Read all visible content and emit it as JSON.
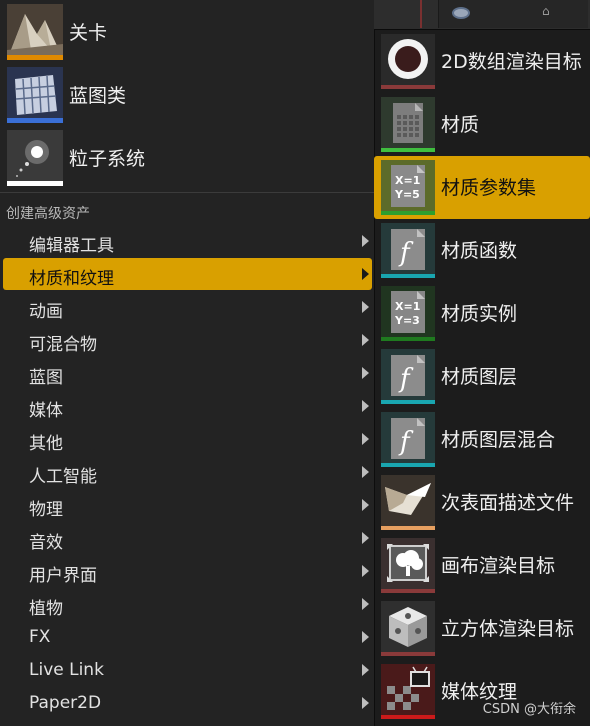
{
  "basic_assets": [
    {
      "label": "关卡",
      "bar_color": "#e08a00"
    },
    {
      "label": "蓝图类",
      "bar_color": "#3a6fd6"
    },
    {
      "label": "粒子系统",
      "bar_color": "#ffffff"
    }
  ],
  "advanced_header": "创建高级资产",
  "categories": [
    {
      "label": "编辑器工具"
    },
    {
      "label": "材质和纹理"
    },
    {
      "label": "动画"
    },
    {
      "label": "可混合物"
    },
    {
      "label": "蓝图"
    },
    {
      "label": "媒体"
    },
    {
      "label": "其他"
    },
    {
      "label": "人工智能"
    },
    {
      "label": "物理"
    },
    {
      "label": "音效"
    },
    {
      "label": "用户界面"
    },
    {
      "label": "植物"
    },
    {
      "label": "FX"
    },
    {
      "label": "Live Link"
    },
    {
      "label": "Paper2D"
    }
  ],
  "active_category": "材质和纹理",
  "submenu": [
    {
      "label": "2D数组渲染目标",
      "icon": "ring-icon",
      "bar_color": "#8a3a3a"
    },
    {
      "label": "材质",
      "icon": "material-grid-icon",
      "bar_color": "#3fbf3f"
    },
    {
      "label": "材质参数集",
      "icon": "parameter-collection-icon",
      "bar_color": "#2e9e2e",
      "icon_text_1": "X=1",
      "icon_text_2": "Y=5"
    },
    {
      "label": "材质函数",
      "icon": "function-icon",
      "bar_color": "#19a6b0"
    },
    {
      "label": "材质实例",
      "icon": "instance-icon",
      "bar_color": "#1f7a1f",
      "icon_text_1": "X=1",
      "icon_text_2": "Y=3"
    },
    {
      "label": "材质图层",
      "icon": "function-icon",
      "bar_color": "#19a6b0"
    },
    {
      "label": "材质图层混合",
      "icon": "function-icon",
      "bar_color": "#19a6b0"
    },
    {
      "label": "次表面描述文件",
      "icon": "subsurface-icon",
      "bar_color": "#e8a060"
    },
    {
      "label": "画布渲染目标",
      "icon": "canvas-icon",
      "bar_color": "#8a3a3a"
    },
    {
      "label": "立方体渲染目标",
      "icon": "cube-icon",
      "bar_color": "#8a3a3a"
    },
    {
      "label": "媒体纹理",
      "icon": "media-texture-icon",
      "bar_color": "#cc1a1a"
    }
  ],
  "active_submenu": "材质参数集",
  "watermark": "CSDN @大衔余",
  "colors": {
    "accent": "#d9a000",
    "menu_bg": "#232323",
    "submenu_bg": "#1c1c1c"
  }
}
